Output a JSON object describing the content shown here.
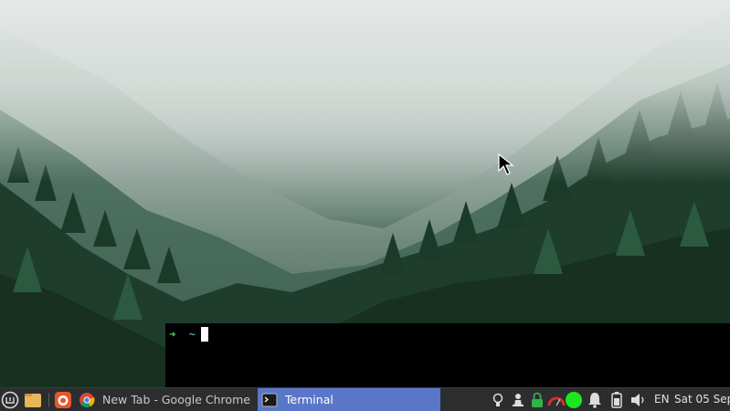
{
  "terminal": {
    "prompt_symbol": "➜",
    "prompt_dir": "~"
  },
  "taskbar": {
    "launchers": [
      {
        "name": "menu-icon"
      },
      {
        "name": "files-icon"
      },
      {
        "name": "firefox-icon"
      }
    ],
    "windows": [
      {
        "label": "New Tab - Google Chrome",
        "icon": "chrome-icon",
        "active": false
      },
      {
        "label": "Terminal",
        "icon": "terminal-icon",
        "active": true
      }
    ],
    "tray": [
      {
        "name": "redshift-bulb-icon"
      },
      {
        "name": "vpn-icon"
      },
      {
        "name": "lock-icon"
      },
      {
        "name": "cpu-gauge-icon"
      },
      {
        "name": "status-dot-icon"
      },
      {
        "name": "notification-bell-icon"
      },
      {
        "name": "battery-icon"
      },
      {
        "name": "volume-icon"
      }
    ],
    "keyboard_layout": "EN",
    "clock": "Sat 05 Sep"
  },
  "colors": {
    "taskbar_bg": "#2c2d2e",
    "active_task": "#5a76c8",
    "prompt_green": "#55d36a",
    "status_green": "#1ee61e"
  }
}
